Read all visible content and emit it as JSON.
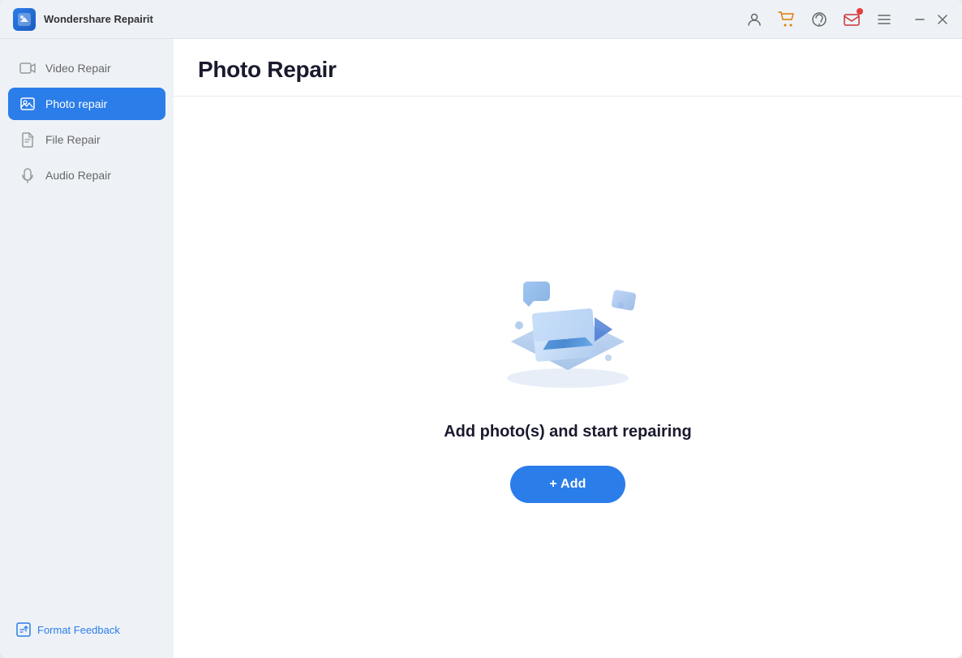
{
  "app": {
    "name": "Wondershare Repairit",
    "logo_alt": "Repairit logo"
  },
  "titlebar": {
    "icons": {
      "account": "account-icon",
      "cart": "cart-icon",
      "support": "support-icon",
      "mail": "mail-icon",
      "menu": "menu-icon",
      "minimize": "minimize-icon",
      "close": "close-icon"
    }
  },
  "sidebar": {
    "items": [
      {
        "id": "video-repair",
        "label": "Video Repair",
        "active": false
      },
      {
        "id": "photo-repair",
        "label": "Photo repair",
        "active": true
      },
      {
        "id": "file-repair",
        "label": "File Repair",
        "active": false
      },
      {
        "id": "audio-repair",
        "label": "Audio Repair",
        "active": false
      }
    ],
    "footer": {
      "feedback_label": "Format Feedback"
    }
  },
  "main": {
    "page_title": "Photo Repair",
    "prompt_text": "Add photo(s) and start repairing",
    "add_button_label": "+ Add"
  }
}
